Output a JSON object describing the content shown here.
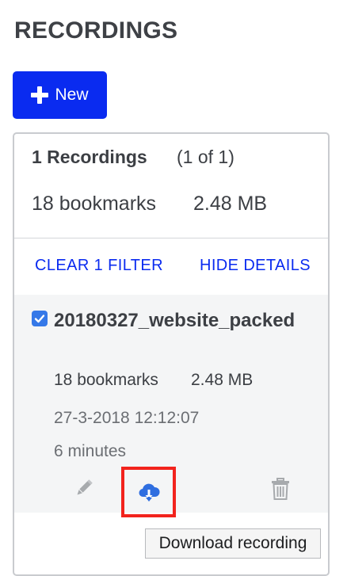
{
  "page": {
    "title": "RECORDINGS"
  },
  "toolbar": {
    "new_label": "New"
  },
  "summary": {
    "count_label": "1 Recordings",
    "page_label": "(1 of 1)",
    "bookmarks_label": "18 bookmarks",
    "size_label": "2.48 MB"
  },
  "filters": {
    "clear_label": "CLEAR 1 FILTER",
    "hide_details_label": "HIDE DETAILS"
  },
  "recordings": [
    {
      "selected": true,
      "name": "20180327_website_packed",
      "bookmarks": "18 bookmarks",
      "size": "2.48 MB",
      "date": "27-3-2018 12:12:07",
      "duration": "6 minutes",
      "actions": [
        "pencil-icon",
        "cloud-download-icon",
        "trash-icon"
      ]
    }
  ],
  "tooltip": {
    "text": "Download recording"
  },
  "colors": {
    "accent": "#0a2bf0",
    "checkbox": "#3578e8",
    "download_icon": "#2f6ee0",
    "highlight_border": "#f2231d",
    "muted_icon": "#a7aaad"
  }
}
